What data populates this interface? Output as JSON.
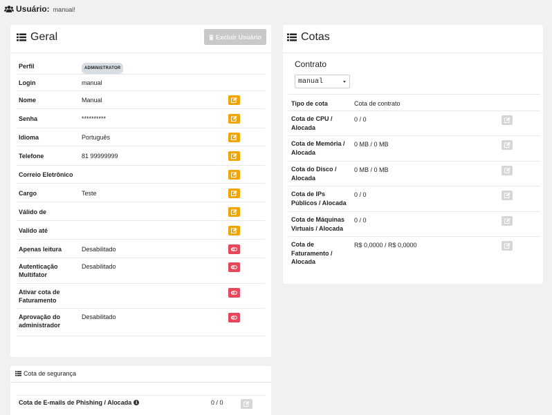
{
  "header": {
    "icon": "users-icon",
    "title": "Usuário:",
    "subtitle": "manual!"
  },
  "geral": {
    "title": "Geral",
    "delete_button": "Excluir Usuário",
    "rows": [
      {
        "label": "Perfil",
        "value": "ADMINISTRATOR",
        "action": "none"
      },
      {
        "label": "Login",
        "value": "manual",
        "action": "none"
      },
      {
        "label": "Nome",
        "value": "Manual",
        "action": "edit"
      },
      {
        "label": "Senha",
        "value": "**********",
        "action": "edit"
      },
      {
        "label": "Idioma",
        "value": "Português",
        "action": "edit"
      },
      {
        "label": "Telefone",
        "value": "81 99999999",
        "action": "edit"
      },
      {
        "label": "Correio Eletrônico",
        "value": "",
        "action": "edit"
      },
      {
        "label": "Cargo",
        "value": "Teste",
        "action": "edit"
      },
      {
        "label": "Válido de",
        "value": "",
        "action": "edit"
      },
      {
        "label": "Valido até",
        "value": "",
        "action": "edit"
      },
      {
        "label": "Apenas leitura",
        "value": "Desabilitado",
        "action": "toggle"
      },
      {
        "label": "Autenticação Multifator",
        "value": "Desabilitado",
        "action": "toggle"
      },
      {
        "label": "Ativar cota de Faturamento",
        "value": "",
        "action": "toggle"
      },
      {
        "label": "Aprovação do administrador",
        "value": "Desabilitado",
        "action": "toggle"
      }
    ]
  },
  "cotas": {
    "title": "Cotas",
    "contrato_label": "Contrato",
    "contrato_value": "manual",
    "tipo_label": "Tipo de cota",
    "tipo_value": "Cota de contrato",
    "rows": [
      {
        "label": "Cota de CPU / Alocada",
        "value": "0 / 0"
      },
      {
        "label": "Cota de Memória / Alocada",
        "value": "0 MB / 0 MB"
      },
      {
        "label": "Cota do Disco / Alocada",
        "value": "0 MB / 0 MB"
      },
      {
        "label": "Cota de IPs Públicos / Alocada",
        "value": "0 / 0"
      },
      {
        "label": "Cota de Máquinas Virtuais / Alocada",
        "value": "0 / 0"
      },
      {
        "label": "Cota de Faturamento / Alocada",
        "value": "R$ 0,0000 / R$ 0,0000"
      }
    ]
  },
  "seguranca": {
    "title": "Cota de segurança",
    "row_label": "Cota de E-mails de Phishing / Alocada",
    "row_value": "0 / 0"
  },
  "colors": {
    "edit": "#f0a500",
    "toggle": "#e5485a",
    "disabled": "#d6d6d6"
  }
}
